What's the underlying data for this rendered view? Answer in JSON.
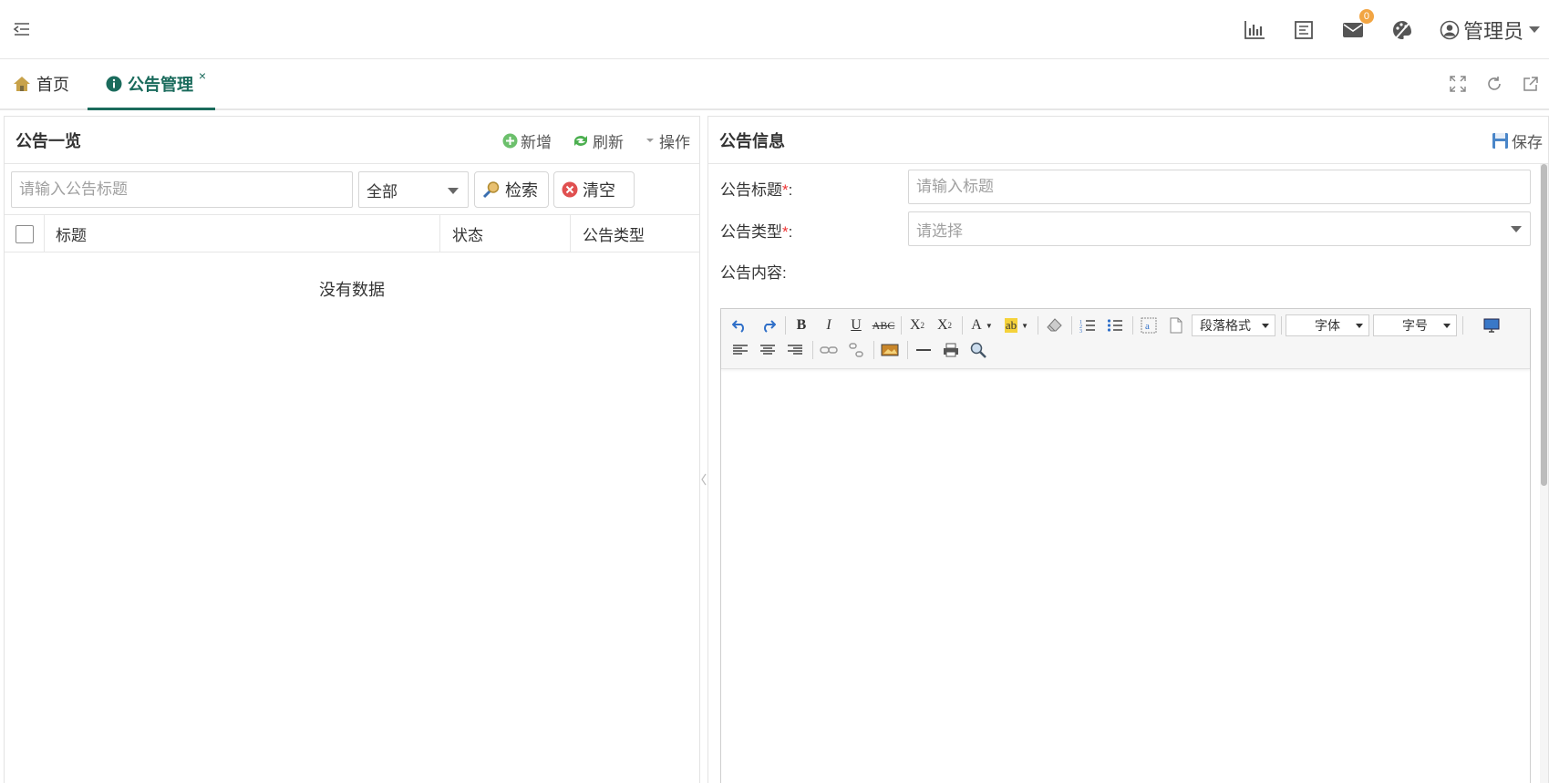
{
  "header": {
    "badge_count": "0",
    "user_name": "管理员"
  },
  "tabs": [
    {
      "label": "首页"
    },
    {
      "label": "公告管理",
      "close": "×"
    }
  ],
  "left_panel": {
    "title": "公告一览",
    "actions": {
      "add": "新增",
      "refresh": "刷新",
      "operate": "操作"
    },
    "search_placeholder": "请输入公告标题",
    "status_select": "全部",
    "search_button": "检索",
    "clear_button": "清空",
    "columns": [
      "标题",
      "状态",
      "公告类型"
    ],
    "empty_text": "没有数据"
  },
  "right_panel": {
    "title": "公告信息",
    "save_button": "保存",
    "fields": {
      "title_label": "公告标题",
      "title_placeholder": "请输入标题",
      "type_label": "公告类型",
      "type_placeholder": "请选择",
      "content_label": "公告内容:",
      "required_mark": "*",
      "colon": ":"
    },
    "editor": {
      "paragraph_format": "段落格式",
      "font_family": "字体",
      "font_size": "字号"
    }
  },
  "colors": {
    "accent": "#1a6b5c",
    "badge": "#f2a543",
    "required": "#e33333"
  }
}
